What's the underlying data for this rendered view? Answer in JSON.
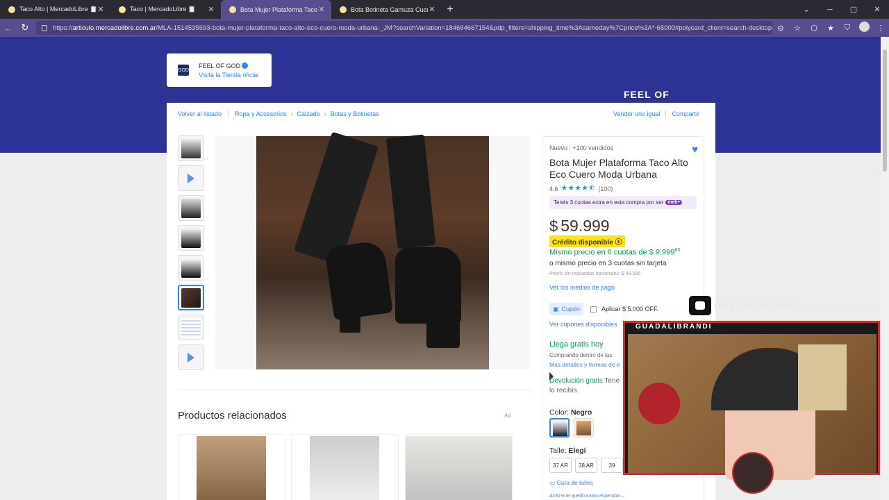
{
  "browser": {
    "tabs": [
      {
        "title": "Taco Alto | MercadoLibre 📋"
      },
      {
        "title": "Taco | MercadoLibre 📋"
      },
      {
        "title": "Bota Mujer Plataforma Taco Alto E"
      },
      {
        "title": "Bota Botineta Gamuza Cuero Muje"
      }
    ],
    "url_prefix": "https://",
    "url_domain": "articulo.mercadolibre.com.ar",
    "url_rest": "/MLA-1514535593-bota-mujer-plataforma-taco-alto-eco-cuero-moda-urbana-_JM?searchVariation=184694667154&pdp_filters=shipping_time%3Asameday%7Cprice%3A*-65000#polycard_client=search-desktop&..."
  },
  "store": {
    "name": "FEEL OF GOD",
    "link": "Visita la Tienda oficial",
    "banner_text": "FEEL OF"
  },
  "breadcrumbs": {
    "back": "Volver al listado",
    "items": [
      "Ropa y Accesorios",
      "Calzado",
      "Botas y Botinetas"
    ],
    "sell": "Vender uno igual",
    "share": "Compartir"
  },
  "related": {
    "title": "Productos relacionados",
    "ad": "Ad"
  },
  "product": {
    "condition": "Nuevo",
    "sold": "+100 vendidos",
    "title": "Bota Mujer Plataforma Taco Alto Eco Cuero Moda Urbana",
    "rating": "4.6",
    "reviews": "(100)",
    "meli_text": "Tenés 3 cuotas extra en esta compra por ser",
    "meli_badge": "meli+",
    "currency": "$",
    "price": "59.999",
    "credit": "Crédito disponible",
    "same_price": "Mismo precio en 6 cuotas de $ 9.999",
    "same_price_cents": "83",
    "no_card": "o mismo precio en 3 cuotas sin tarjeta",
    "no_tax": "Precio sin impuestos nacionales: $ 49.586",
    "payment_link": "Ver los medios de pago",
    "coupon": "Cupón",
    "apply": "Aplicar $ 5.000 OFF.",
    "coupons_link": "Ver cupones disponibles",
    "arrives": "Llega gratis hoy",
    "buying": "Comprando dentro de las",
    "more_details": "Más detalles y formas de e",
    "returns": "Devolución gratis",
    "returns_rest": "Tene",
    "returns_line2": "lo recibís.",
    "color_label": "Color:",
    "color_value": "Negro",
    "size_label": "Talle:",
    "size_value": "Elegí",
    "sizes": [
      "37 AR",
      "38 AR",
      "39"
    ],
    "size_guide": "Guía de talles",
    "fit": "Al 81% le quedó como esperaba"
  },
  "stream": {
    "channel": "GUADALIBRANDI",
    "yt_name": "GUADALIBRANDI"
  }
}
